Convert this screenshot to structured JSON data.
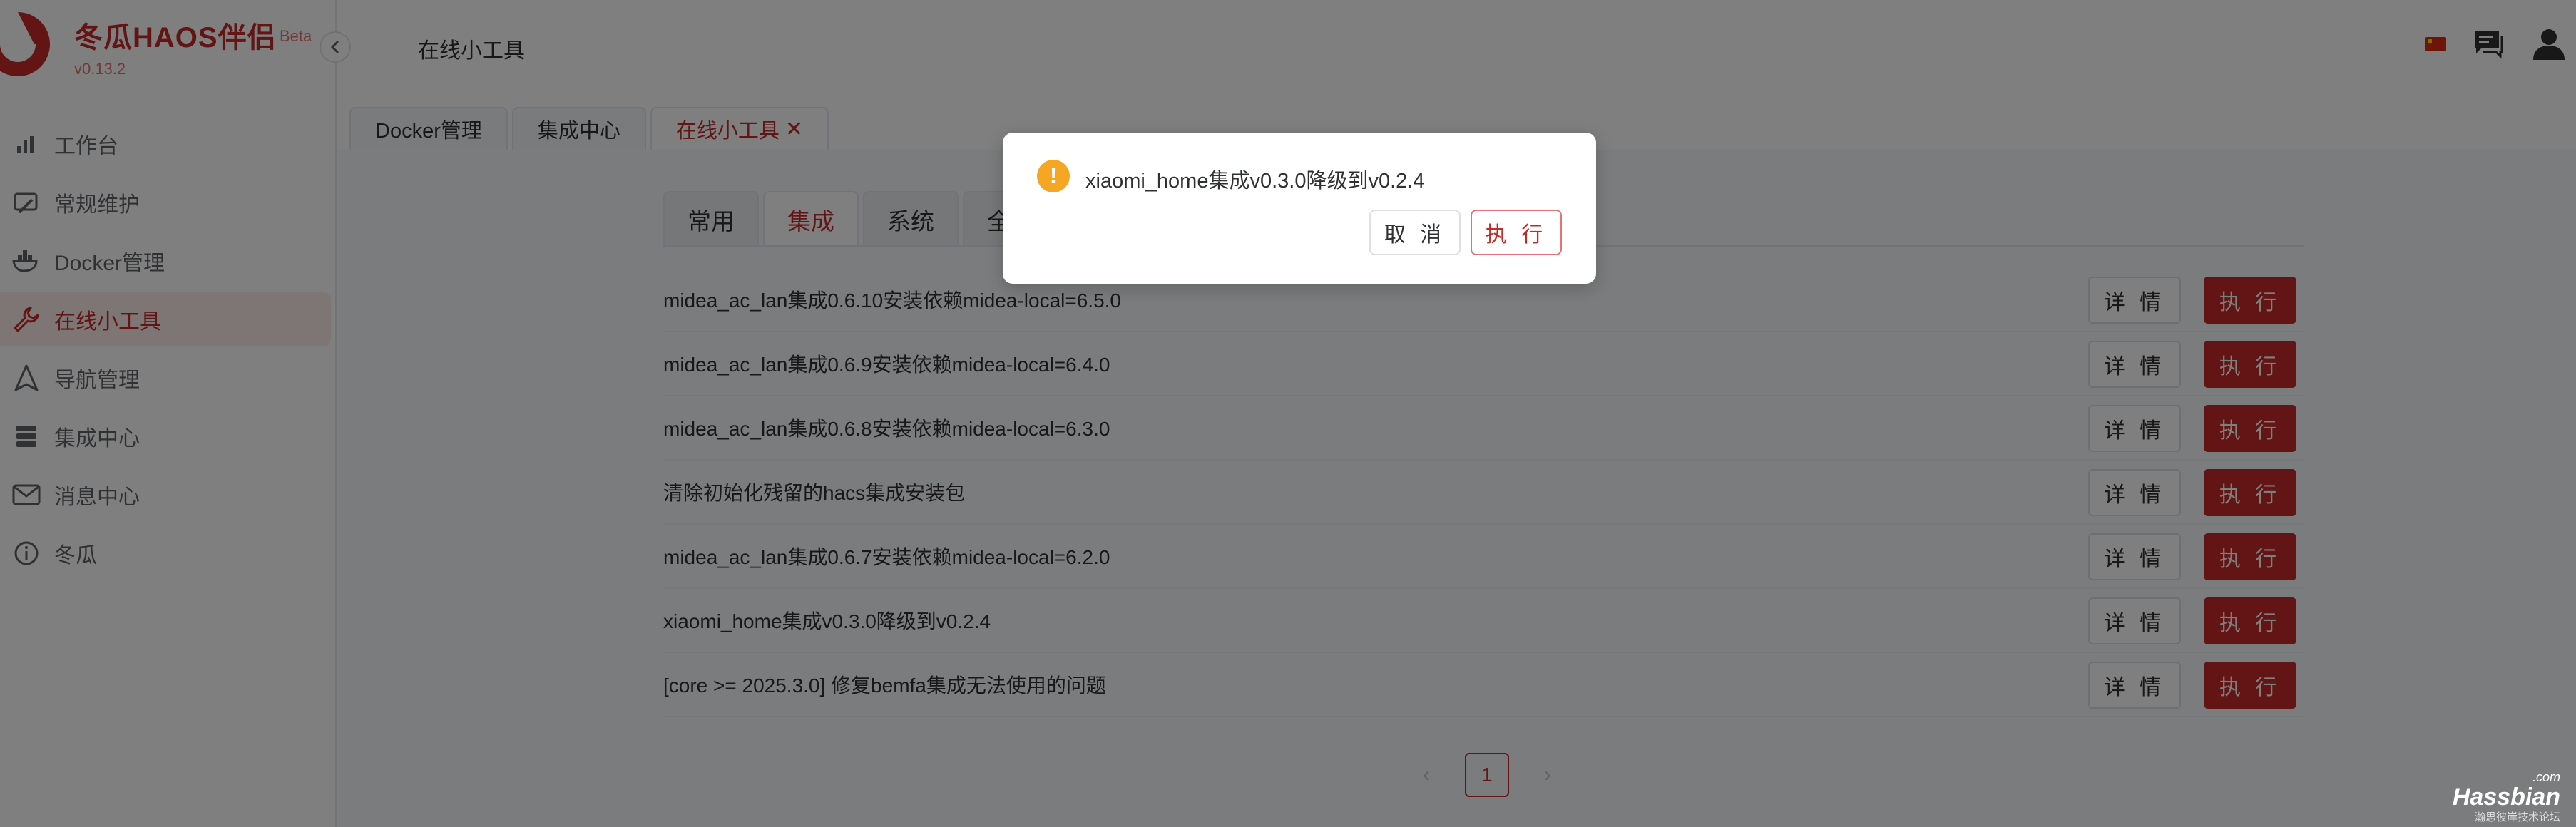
{
  "app": {
    "title": "冬瓜HAOS伴侣",
    "beta": "Beta",
    "version": "v0.13.2"
  },
  "sidebar": {
    "items": [
      {
        "label": "工作台",
        "icon": "dashboard-icon"
      },
      {
        "label": "常规维护",
        "icon": "tools-icon"
      },
      {
        "label": "Docker管理",
        "icon": "docker-icon"
      },
      {
        "label": "在线小工具",
        "icon": "wrench-icon",
        "active": true
      },
      {
        "label": "导航管理",
        "icon": "navigation-icon"
      },
      {
        "label": "集成中心",
        "icon": "server-icon"
      },
      {
        "label": "消息中心",
        "icon": "mail-icon"
      },
      {
        "label": "冬瓜",
        "icon": "info-icon"
      }
    ]
  },
  "header": {
    "title": "在线小工具",
    "icons": [
      "china-flag-icon",
      "chat-icon",
      "user-icon"
    ]
  },
  "tabs": [
    {
      "label": "Docker管理"
    },
    {
      "label": "集成中心"
    },
    {
      "label": "在线小工具",
      "active": true,
      "close": "✕"
    }
  ],
  "subtabs": [
    {
      "label": "常用"
    },
    {
      "label": "集成",
      "active": true
    },
    {
      "label": "系统"
    },
    {
      "label": "全"
    }
  ],
  "rows": [
    {
      "text": "midea_ac_lan集成0.6.10安装依赖midea-local=6.5.0"
    },
    {
      "text": "midea_ac_lan集成0.6.9安装依赖midea-local=6.4.0"
    },
    {
      "text": "midea_ac_lan集成0.6.8安装依赖midea-local=6.3.0"
    },
    {
      "text": "清除初始化残留的hacs集成安装包"
    },
    {
      "text": "midea_ac_lan集成0.6.7安装依赖midea-local=6.2.0"
    },
    {
      "text": "xiaomi_home集成v0.3.0降级到v0.2.4"
    },
    {
      "text": "[core >= 2025.3.0] 修复bemfa集成无法使用的问题"
    }
  ],
  "row_buttons": {
    "detail": "详 情",
    "exec": "执 行"
  },
  "pagination": {
    "prev": "‹",
    "current": "1",
    "next": "›"
  },
  "dialog": {
    "icon": "!",
    "message": "xiaomi_home集成v0.3.0降级到v0.2.4",
    "cancel": "取 消",
    "confirm": "执 行"
  },
  "watermark": {
    "com": ".com",
    "main": "Hassbian",
    "sub": "瀚思彼岸技术论坛"
  },
  "colors": {
    "accent": "#c62828",
    "warning": "#f5a623",
    "overlay": "rgba(0,0,0,0.5)"
  }
}
